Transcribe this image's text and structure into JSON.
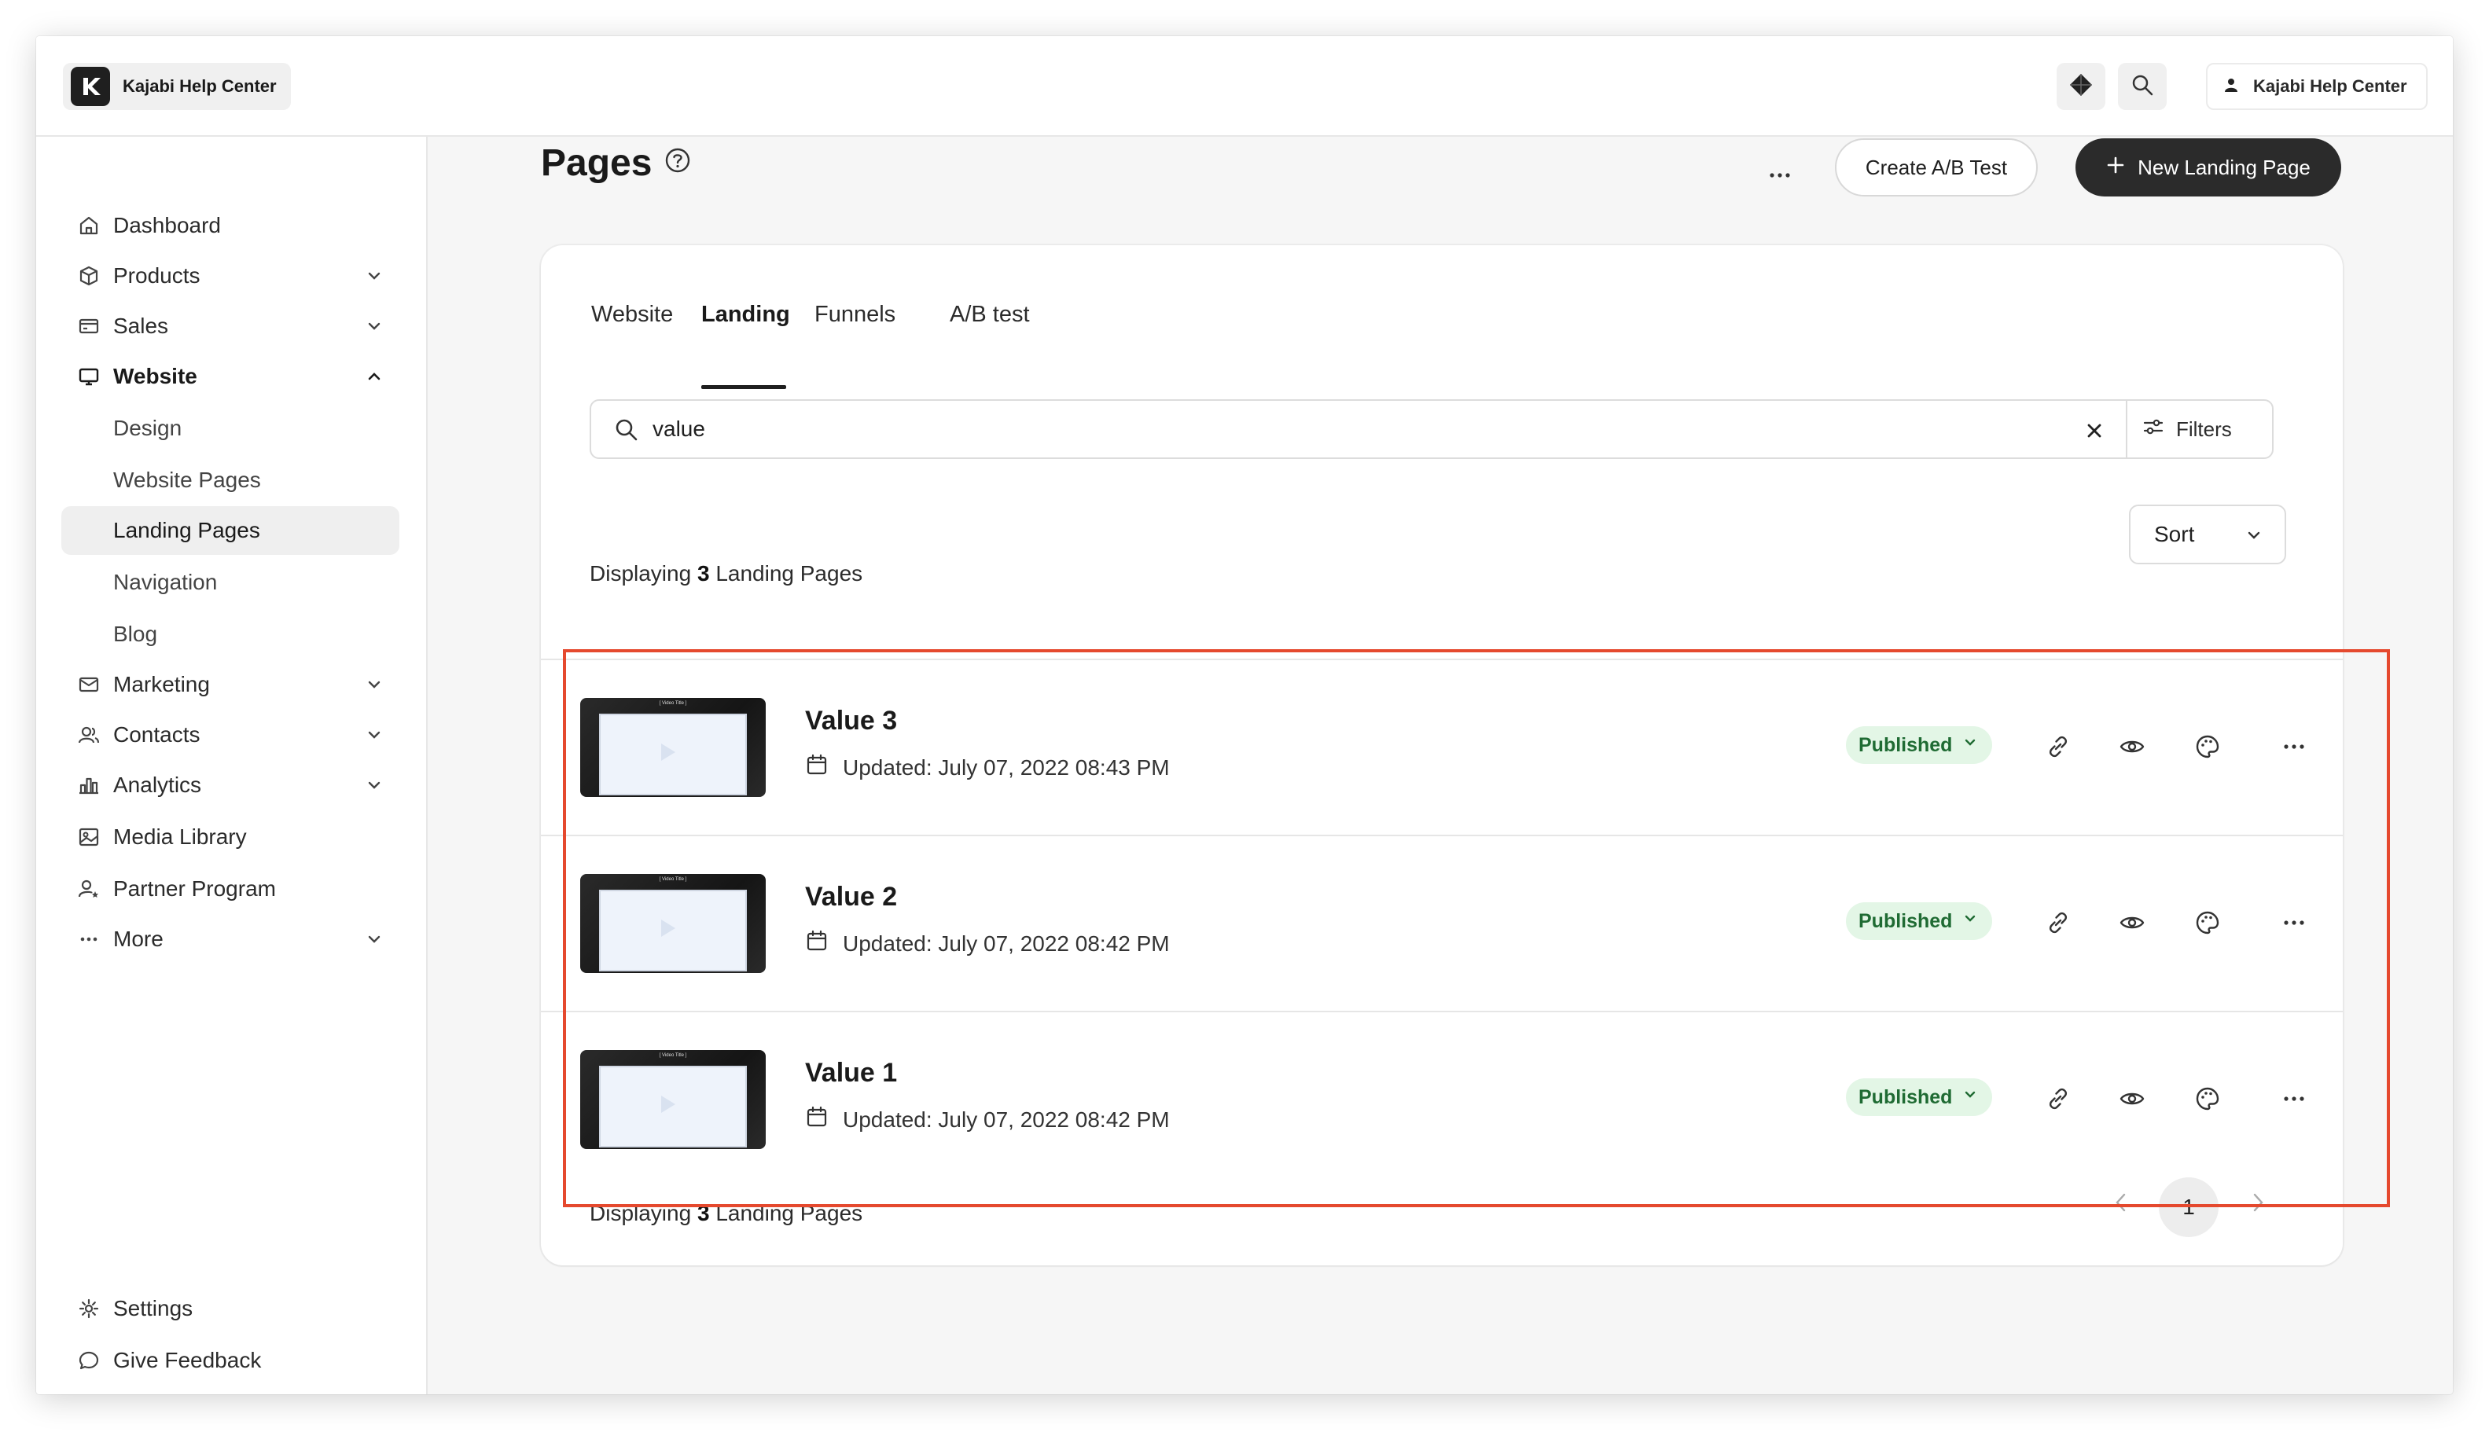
{
  "brand": {
    "name": "Kajabi Help Center"
  },
  "account": {
    "name": "Kajabi Help Center"
  },
  "sidebar": {
    "items": [
      {
        "label": "Dashboard"
      },
      {
        "label": "Products"
      },
      {
        "label": "Sales"
      },
      {
        "label": "Website"
      },
      {
        "label": "Design"
      },
      {
        "label": "Website Pages"
      },
      {
        "label": "Landing Pages"
      },
      {
        "label": "Navigation"
      },
      {
        "label": "Blog"
      },
      {
        "label": "Marketing"
      },
      {
        "label": "Contacts"
      },
      {
        "label": "Analytics"
      },
      {
        "label": "Media Library"
      },
      {
        "label": "Partner Program"
      },
      {
        "label": "More"
      }
    ],
    "footer": [
      {
        "label": "Settings"
      },
      {
        "label": "Give Feedback"
      }
    ]
  },
  "header": {
    "title": "Pages",
    "ab_test_label": "Create A/B Test",
    "new_page_label": "New Landing Page"
  },
  "tabs": [
    {
      "label": "Website"
    },
    {
      "label": "Landing"
    },
    {
      "label": "Funnels"
    },
    {
      "label": "A/B test"
    }
  ],
  "search": {
    "value": "value",
    "filters_label": "Filters"
  },
  "count": {
    "prefix": "Displaying",
    "number": "3",
    "suffix": "Landing Pages"
  },
  "sort": {
    "label": "Sort"
  },
  "pages": [
    {
      "title": "Value 3",
      "updated": "Updated: July 07, 2022 08:43 PM",
      "status": "Published",
      "thumb_caption": "[ Video Title ]"
    },
    {
      "title": "Value 2",
      "updated": "Updated: July 07, 2022 08:42 PM",
      "status": "Published",
      "thumb_caption": "[ Video Title ]"
    },
    {
      "title": "Value 1",
      "updated": "Updated: July 07, 2022 08:42 PM",
      "status": "Published",
      "thumb_caption": "[ Video Title ]"
    }
  ],
  "pagination": {
    "current": "1"
  },
  "colors": {
    "accent_dark": "#2b2b2b",
    "highlight": "#e5492e",
    "status_bg": "#e3f6e6",
    "status_text": "#1f6b33"
  }
}
